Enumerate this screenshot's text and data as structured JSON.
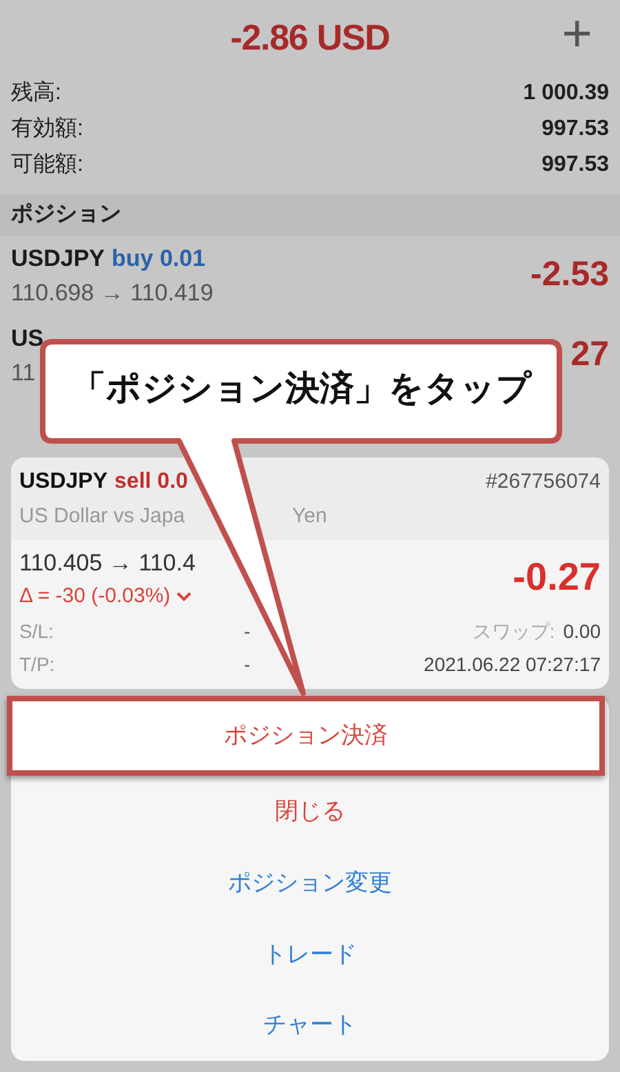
{
  "header": {
    "total": "-2.86 USD",
    "add_button": "+"
  },
  "summary": [
    {
      "label": "残高:",
      "value": "1 000.39"
    },
    {
      "label": "有効額:",
      "value": "997.53"
    },
    {
      "label": "可能額:",
      "value": "997.53"
    }
  ],
  "section_title": "ポジション",
  "positions": [
    {
      "symbol": "USDJPY",
      "order": "buy 0.01",
      "color": "#2a63a8",
      "prices": "110.698 → 110.419",
      "profit": "-2.53"
    },
    {
      "symbol": "US",
      "prices": "11",
      "profit": "27"
    }
  ],
  "detail_card": {
    "symbol": "USDJPY",
    "order": "sell 0.0",
    "color": "#c1302b",
    "ticket": "#267756074",
    "description": "US Dollar vs Japa",
    "description_tail": "Yen",
    "prices": "110.405 → 110.4",
    "delta": "Δ = -30 (-0.03%)",
    "profit": "-0.27",
    "fields": [
      {
        "label": "S/L:",
        "value": "-",
        "label_2": "スワップ:",
        "value_2": "0.00"
      },
      {
        "label": "T/P:",
        "value": "-",
        "value_2": "2021.06.22 07:27:17"
      }
    ]
  },
  "menu": [
    {
      "label": "ポジション決済",
      "kind": "destructive",
      "highlighted": true
    },
    {
      "label": "閉じる",
      "kind": "destructive",
      "highlighted": false
    },
    {
      "label": "ポジション変更",
      "kind": "action",
      "highlighted": false
    },
    {
      "label": "トレード",
      "kind": "action",
      "highlighted": false
    },
    {
      "label": "チャート",
      "kind": "action",
      "highlighted": false
    }
  ],
  "callout": {
    "text": "「ポジション決済」をタップ"
  }
}
